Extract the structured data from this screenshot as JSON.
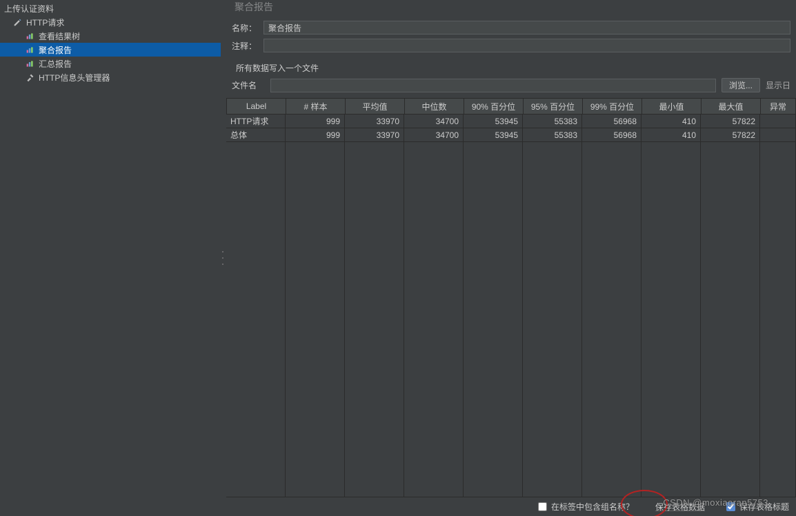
{
  "sidebar": {
    "items": [
      {
        "label": "上传认证资料",
        "icon": "folder"
      },
      {
        "label": "HTTP请求",
        "icon": "pencil"
      },
      {
        "label": "查看结果树",
        "icon": "chart"
      },
      {
        "label": "聚合报告",
        "icon": "chart",
        "selected": true
      },
      {
        "label": "汇总报告",
        "icon": "chart"
      },
      {
        "label": "HTTP信息头管理器",
        "icon": "wrench"
      }
    ]
  },
  "panel": {
    "title_cut": "聚合报告",
    "name_label": "名称：",
    "name_value": "聚合报告",
    "comment_label": "注释：",
    "comment_value": "",
    "file_section_title": "所有数据写入一个文件",
    "file_label": "文件名",
    "file_value": "",
    "browse_label": "浏览...",
    "trailing_label": "显示日"
  },
  "table": {
    "headers": [
      "Label",
      "# 样本",
      "平均值",
      "中位数",
      "90% 百分位",
      "95% 百分位",
      "99% 百分位",
      "最小值",
      "最大值",
      "异常"
    ],
    "rows": [
      {
        "label": "HTTP请求",
        "values": [
          "999",
          "33970",
          "34700",
          "53945",
          "55383",
          "56968",
          "410",
          "57822"
        ]
      },
      {
        "label": "总体",
        "values": [
          "999",
          "33970",
          "34700",
          "53945",
          "55383",
          "56968",
          "410",
          "57822"
        ]
      }
    ]
  },
  "footer": {
    "include_group_label": "在标签中包含组名称？",
    "include_group_checked": false,
    "save_data_label": "保存表格数据",
    "save_header_label": "保存表格标题",
    "save_header_checked": true
  },
  "watermark": "CSDN @moxiaoran5753"
}
